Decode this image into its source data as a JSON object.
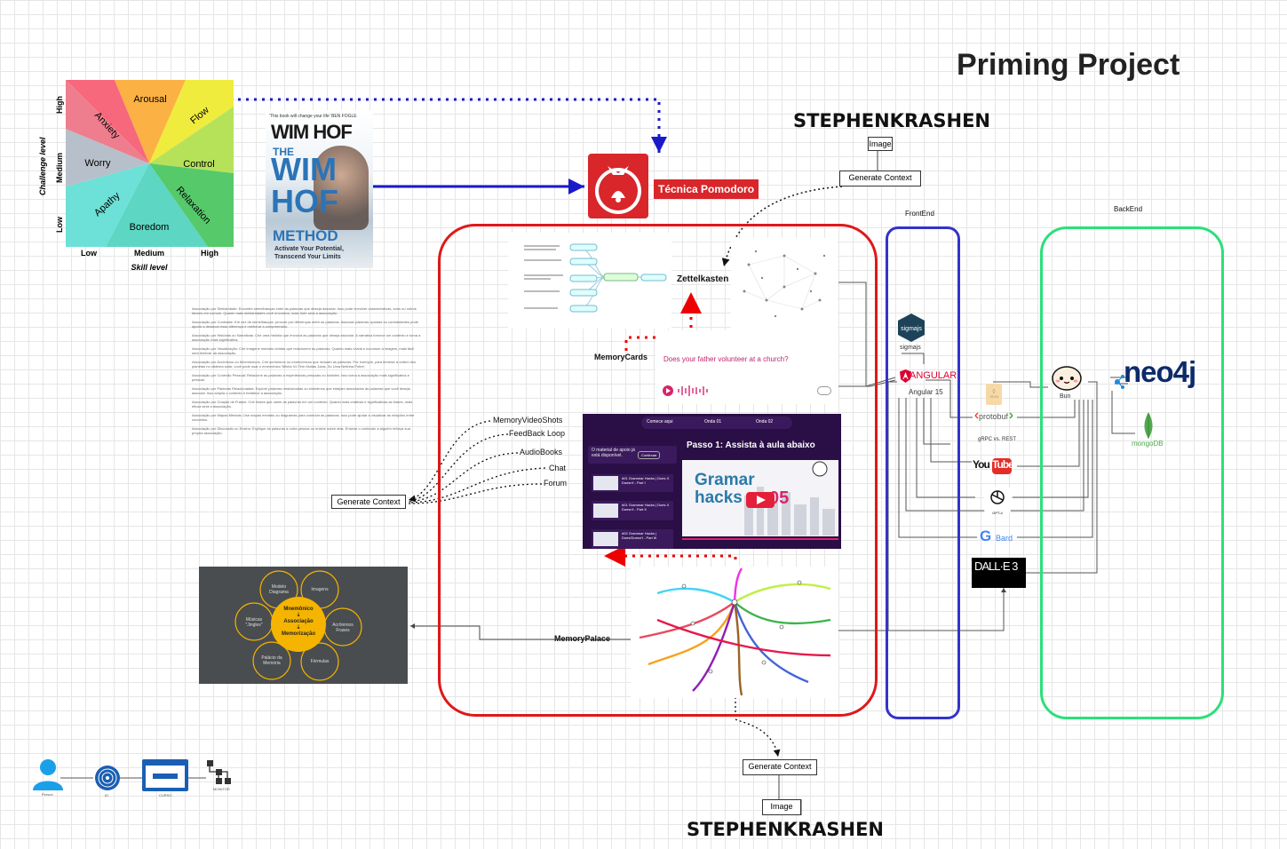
{
  "title": "Priming Project",
  "krashen_top": "STEPHENKRASHEN",
  "krashen_bottom": "STEPHENKRASHEN",
  "flow": {
    "sectors": [
      "Arousal",
      "Flow",
      "Anxiety",
      "Worry",
      "Control",
      "Apathy",
      "Relaxation",
      "Boredom"
    ],
    "y_ticks": [
      "High",
      "Medium",
      "Low"
    ],
    "x_ticks": [
      "Low",
      "Medium",
      "High"
    ],
    "ylabel": "Challenge level",
    "xlabel": "Skill level"
  },
  "book": {
    "quote": "'This book will change your life' BEN FOGLE",
    "author": "WIM HOF",
    "the": "THE",
    "line1": "WIM",
    "line2": "HOF",
    "line3": "METHOD",
    "sub1": "Activate Your Potential,",
    "sub2": "Transcend Your Limits"
  },
  "pomodoro": "Técnica Pomodoro",
  "image_top": "Image",
  "gen_top": "Generate Context",
  "frontend_label": "FrontEnd",
  "backend_label": "BackEnd",
  "zettel": "Zettelkasten",
  "memorycards": "MemoryCards",
  "question": "Does your father volunteer at a church?",
  "left_list": [
    "MemoryVideoShots",
    "FeedBack Loop",
    "AudioBooks",
    "Chat",
    "Forum"
  ],
  "gen_left": "Generate Context",
  "course": {
    "tabs": [
      "Comece aqui",
      "Onda 01",
      "Onda 02"
    ],
    "heading": "Passo 1: Assista à aula abaixo",
    "side_title": "O material de apoio já está disponível.",
    "side_btn": "Continuar",
    "lessons": [
      "#01 Grammar Hacks | Does X Doesn't - Part I",
      "#01 Grammar Hacks | Does X Doesn't - Part II",
      "#02 Grammar Hacks | Does/Doesn't - Part III"
    ],
    "video_text1": "Gramar",
    "video_text2": "hacks",
    "video_num": "05"
  },
  "memorypalace": "MemoryPalace",
  "mnemo": {
    "center1": "Mnemônico",
    "center2": "Associação",
    "center3": "Memorização",
    "petals": [
      "Modelo Diagrama",
      "Imagens",
      "Acrônimos Frases",
      "Fórmulas",
      "Palácio da Memória",
      "Músicas \"Jingles\""
    ]
  },
  "gen_bottom": "Generate Context",
  "image_bottom": "Image",
  "tech": {
    "sigmajs": "sigmajs",
    "angular": "ANGULAR",
    "angular_ver": "Angular 15",
    "json": "JSON",
    "protobuf": "protobuf",
    "grpc": "gRPC vs. REST",
    "youtube": "YouTube",
    "gpt": "GPT-4",
    "bard": "Bard",
    "dalle": "DALL·E 3",
    "bun": "Bun",
    "neo4j": "neo4j",
    "mongodb": "mongoDB"
  },
  "flow_icons": [
    "Person",
    "ID",
    "CURSO",
    "MONITOR"
  ],
  "text_block": [
    "Associação por Similaridade: Encontre semelhanças entre as palavras que deseja associar. Isso pode envolver características, sons ou outros fatores em comum. Quanto mais similaridades você encontrar, mais forte será a associação.",
    "Associação por Contraste: Em vez de semelhanças, procure por diferenças entre as palavras. Associar palavras opostas ou contrastantes pode ajudar a destacar essa diferença e melhorar a compreensão.",
    "Associação por Histórias ou Narrativas: Crie uma história que envolva as palavras que deseja associar. A narrativa fornece um contexto e torna a associação mais significativa.",
    "Associação por Visualização: Crie imagens mentais vívidas que relacionem as palavras. Quanto mais vívida e incomum a imagem, mais fácil será lembrar da associação.",
    "Associação por Acrônimos ou Mnemônicos: Crie acrônimos ou mnemônicos que incluam as palavras. Por exemplo, para lembrar a ordem dos planetas no sistema solar, você pode usar o mnemônico 'Minha Vó Tem Muitas Joias, Só Uma Netinha Pobre'.",
    "Associação por Conexão Pessoal: Relacione as palavras a experiências pessoais ou hobbies. Isso torna a associação mais significativa e pessoal.",
    "Associação por Palavras Relacionadas: Explore palavras relacionadas ou sinônimos que estejam associados às palavras que você deseja associar. Isso amplia o contexto e fortalece a associação.",
    "Associação por Criação de Frases: Crie frases que usem as palavras em um contexto. Quanto mais criativas e significativas as frases, mais eficaz será a associação.",
    "Associação por Mapas Mentais: Use mapas mentais ou diagramas para conectar as palavras. Isso pode ajudar a visualizar as relações entre conceitos.",
    "Associação por Discussão ou Ensino: Explique as palavras a outra pessoa ou ensine sobre elas. Ensinar o conteúdo a alguém reforça sua própria associação."
  ]
}
